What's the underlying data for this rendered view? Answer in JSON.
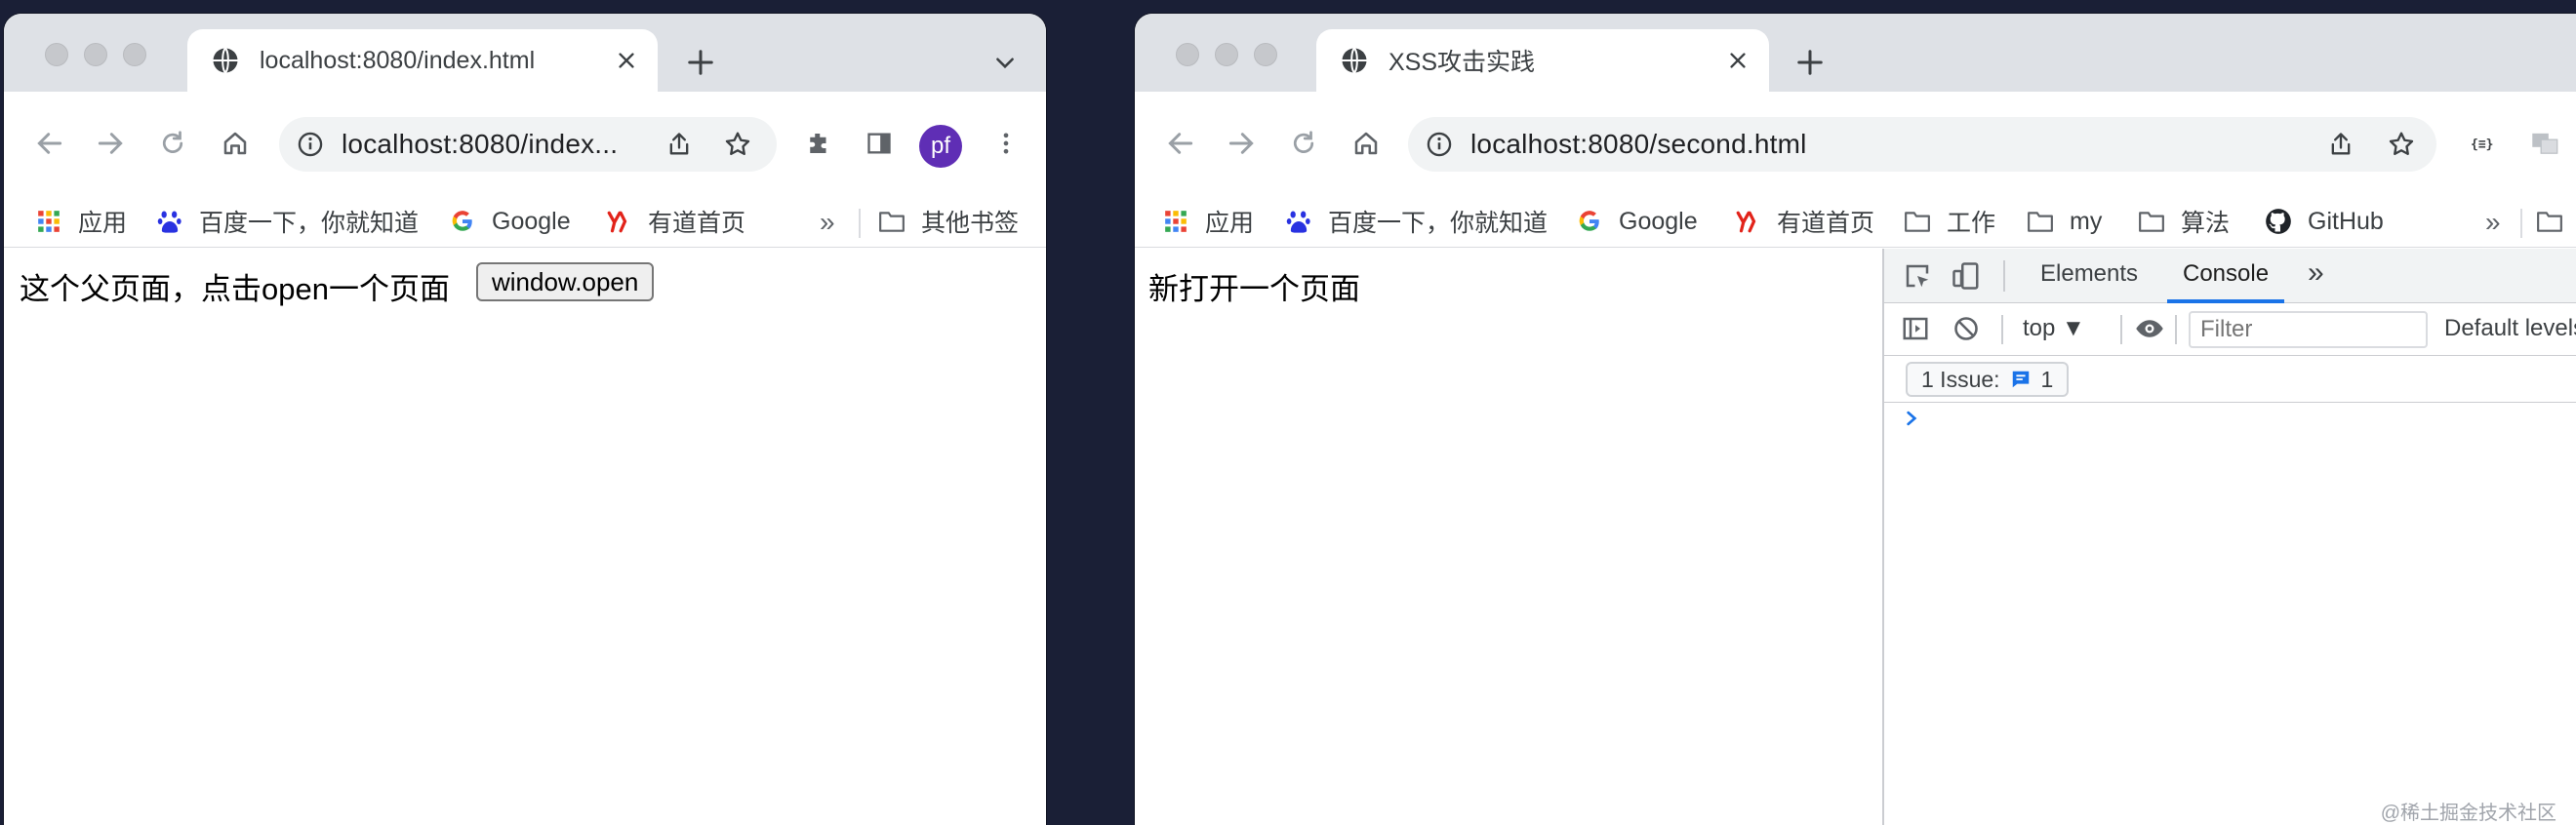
{
  "window1": {
    "tab_title": "localhost:8080/index.html",
    "url": "localhost:8080/index...",
    "avatar_initials": "pf",
    "bookmarks": [
      "应用",
      "百度一下，你就知道",
      "Google",
      "有道首页"
    ],
    "bookmarks_overflow": "»",
    "other_bookmarks": "其他书签",
    "page_text": "这个父页面，点击open一个页面",
    "page_button": "window.open"
  },
  "window2": {
    "tab_title": "XSS攻击实践",
    "url": "localhost:8080/second.html",
    "bookmarks": [
      "应用",
      "百度一下，你就知道",
      "Google",
      "有道首页",
      "工作",
      "my",
      "算法",
      "GitHub"
    ],
    "bookmarks_overflow": "»",
    "page_text": "新打开一个页面",
    "devtools": {
      "tabs": [
        "Elements",
        "Console"
      ],
      "tabs_overflow": "»",
      "issue_count": "1",
      "context": "top ▼",
      "filter_placeholder": "Filter",
      "levels": "Default levels",
      "issues_label": "1 Issue:",
      "issues_count": "1"
    }
  },
  "watermark": "@稀土掘金技术社区",
  "colors": {
    "accent": "#1a73e8",
    "avatar": "#5f2eb5",
    "tabstrip": "#dee1e6",
    "desktop": "#1a1f36"
  }
}
